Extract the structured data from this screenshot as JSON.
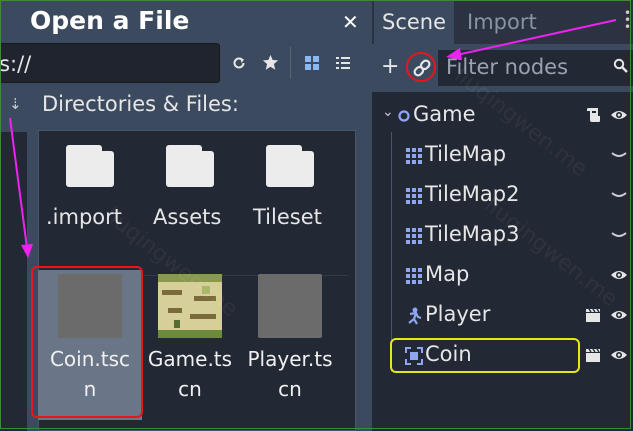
{
  "dialog": {
    "title": "Open a File",
    "path": "res://",
    "directories_label": "Directories & Files:",
    "folders": [
      {
        "name": ".import"
      },
      {
        "name": "Assets"
      },
      {
        "name": "Tileset"
      }
    ],
    "scenes": [
      {
        "line1": "Coin.tsc",
        "line2": "n"
      },
      {
        "line1": "Game.ts",
        "line2": "cn"
      },
      {
        "line1": "Player.ts",
        "line2": "cn"
      }
    ]
  },
  "scene_dock": {
    "tabs": [
      "Scene",
      "Import"
    ],
    "filter_placeholder": "Filter nodes",
    "nodes": [
      {
        "name": "Game",
        "icon": "node2d-icon"
      },
      {
        "name": "TileMap",
        "icon": "tilemap-icon"
      },
      {
        "name": "TileMap2",
        "icon": "tilemap-icon"
      },
      {
        "name": "TileMap3",
        "icon": "tilemap-icon"
      },
      {
        "name": "Map",
        "icon": "tilemap-icon"
      },
      {
        "name": "Player",
        "icon": "kinematic-body-icon"
      },
      {
        "name": "Coin",
        "icon": "area2d-icon"
      }
    ]
  },
  "watermark": "liuqingwen.me",
  "colors": {
    "accent_node": "#8da5f3",
    "annotation_arrow": "#ee22ee",
    "annotation_red": "#e8161c",
    "annotation_yellow": "#e4e81a"
  }
}
